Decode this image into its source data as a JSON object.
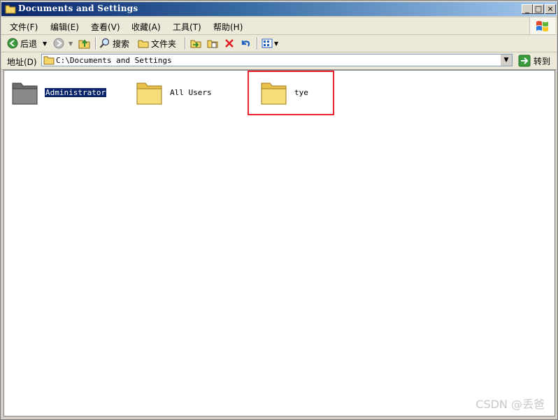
{
  "window": {
    "title": "Documents and Settings",
    "controls": {
      "minimize": "_",
      "maximize": "□",
      "close": "×"
    }
  },
  "menu": {
    "items": [
      {
        "label": "文件(F)"
      },
      {
        "label": "编辑(E)"
      },
      {
        "label": "查看(V)"
      },
      {
        "label": "收藏(A)"
      },
      {
        "label": "工具(T)"
      },
      {
        "label": "帮助(H)"
      }
    ]
  },
  "toolbar": {
    "back": "后退",
    "search": "搜索",
    "folders": "文件夹"
  },
  "address": {
    "label": "地址(D)",
    "value": "C:\\Documents and Settings",
    "go": "转到"
  },
  "folders": [
    {
      "name": "Administrator",
      "selected": true,
      "icon": "folder-user-icon"
    },
    {
      "name": "All Users",
      "selected": false,
      "icon": "folder-icon"
    },
    {
      "name": "tye",
      "selected": false,
      "icon": "folder-icon"
    }
  ],
  "watermark": "CSDN @丢爸",
  "colors": {
    "title_start": "#0a246a",
    "title_end": "#a6caf0",
    "highlight": "#e8212f",
    "selection": "#0a246a"
  }
}
